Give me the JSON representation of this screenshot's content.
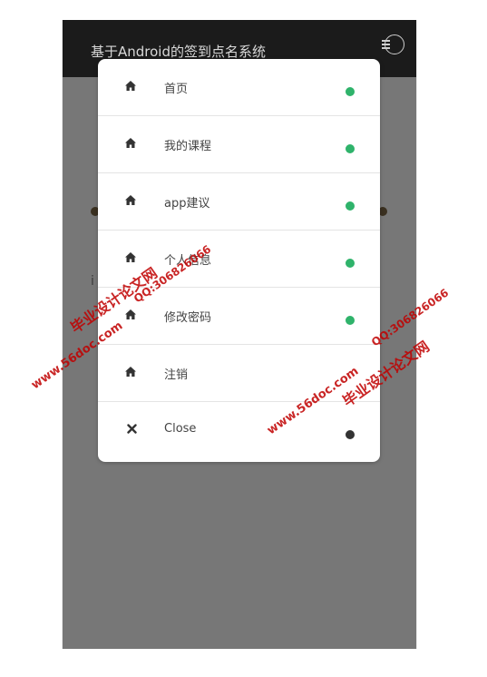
{
  "app": {
    "title": "基于Android的签到点名系统",
    "background_letter": "i"
  },
  "menu": {
    "items": [
      {
        "label": "首页",
        "icon": "home-icon",
        "dot_color": "#2fb36b"
      },
      {
        "label": "我的课程",
        "icon": "home-icon",
        "dot_color": "#2fb36b"
      },
      {
        "label": "app建议",
        "icon": "home-icon",
        "dot_color": "#2fb36b"
      },
      {
        "label": "个人信息",
        "icon": "home-icon",
        "dot_color": "#2fb36b"
      },
      {
        "label": "修改密码",
        "icon": "home-icon",
        "dot_color": "#2fb36b"
      },
      {
        "label": "注销",
        "icon": "home-icon",
        "dot_color": null
      },
      {
        "label": "Close",
        "icon": "close-icon",
        "dot_color": "#333333"
      }
    ]
  },
  "watermark": {
    "cn_text": "毕业设计论文网",
    "site": "www.56doc.com",
    "qq": "QQ:306826066",
    "color": "#c00000"
  }
}
